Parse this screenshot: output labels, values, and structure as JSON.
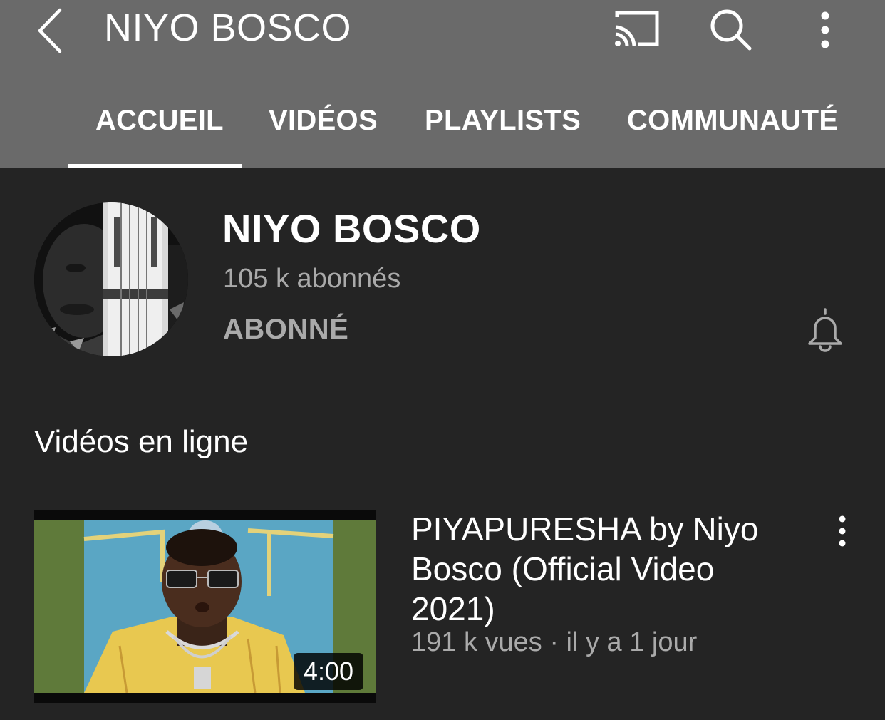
{
  "appbar": {
    "title": "NIYO BOSCO",
    "back_icon": "chevron-left-icon",
    "cast_icon": "cast-icon",
    "search_icon": "search-icon",
    "more_icon": "more-vertical-icon"
  },
  "tabs": [
    {
      "label": "ACCUEIL",
      "selected": true
    },
    {
      "label": "VIDÉOS",
      "selected": false
    },
    {
      "label": "PLAYLISTS",
      "selected": false
    },
    {
      "label": "COMMUNAUTÉ",
      "selected": false
    }
  ],
  "channel": {
    "name": "NIYO BOSCO",
    "subscribers": "105 k abonnés",
    "subscribe_state": "ABONNÉ",
    "bell_icon": "bell-icon"
  },
  "section": {
    "title": "Vidéos en ligne"
  },
  "videos": [
    {
      "title": "PIYAPURESHA by Niyo Bosco (Official Video 2021)",
      "meta": "191 k vues · il y a 1 jour",
      "duration": "4:00"
    }
  ],
  "colors": {
    "appbar_bg": "#6a6a6a",
    "page_bg": "#242424",
    "text_primary": "#ffffff",
    "text_secondary": "#aaaaaa"
  }
}
